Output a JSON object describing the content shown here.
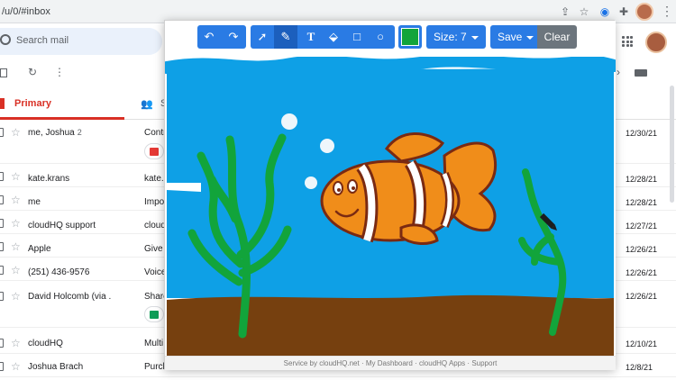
{
  "browser": {
    "url": "/u/0/#inbox"
  },
  "header": {
    "search_placeholder": "Search mail"
  },
  "tabs": {
    "primary": "Primary",
    "social_initial": "S"
  },
  "emails": [
    {
      "sender": "me, Joshua",
      "count": "2",
      "subject": "Contr",
      "date": "12/30/21",
      "attachment": "pdf"
    },
    {
      "sender": "kate.krans",
      "count": "",
      "subject": "kate.",
      "date": "12/28/21",
      "attachment": ""
    },
    {
      "sender": "me",
      "count": "",
      "subject": "Impo",
      "date": "12/28/21",
      "attachment": ""
    },
    {
      "sender": "cloudHQ support",
      "count": "",
      "subject": "cloud",
      "date": "12/27/21",
      "attachment": ""
    },
    {
      "sender": "Apple",
      "count": "",
      "subject": "Give",
      "date": "12/26/21",
      "attachment": ""
    },
    {
      "sender": "(251) 436-9576",
      "count": "",
      "subject": "Voice",
      "date": "12/26/21",
      "attachment": ""
    },
    {
      "sender": "David Holcomb (via .",
      "count": "",
      "subject": "Share",
      "date": "12/26/21",
      "attachment": "sheet"
    },
    {
      "sender": "cloudHQ",
      "count": "",
      "subject": "Multi",
      "date": "12/10/21",
      "attachment": ""
    },
    {
      "sender": "Joshua Brach",
      "count": "",
      "subject": "Purch",
      "date": "12/8/21",
      "attachment": ""
    }
  ],
  "drawing": {
    "size_label": "Size:",
    "size_value": "7",
    "save_label": "Save",
    "clear_label": "Clear",
    "selected_color": "#12a43b",
    "footer": {
      "prefix": "Service by",
      "service": "cloudHQ.net",
      "sep": "·",
      "dashboard": "My Dashboard",
      "apps": "cloudHQ Apps",
      "support": "Support"
    }
  },
  "colors": {
    "accent_blue": "#2a7be4",
    "primary_red": "#d93025",
    "water": "#0ea0e6",
    "sand": "#76400f",
    "fish_orange": "#f08d1a",
    "seaweed": "#12a43b"
  }
}
